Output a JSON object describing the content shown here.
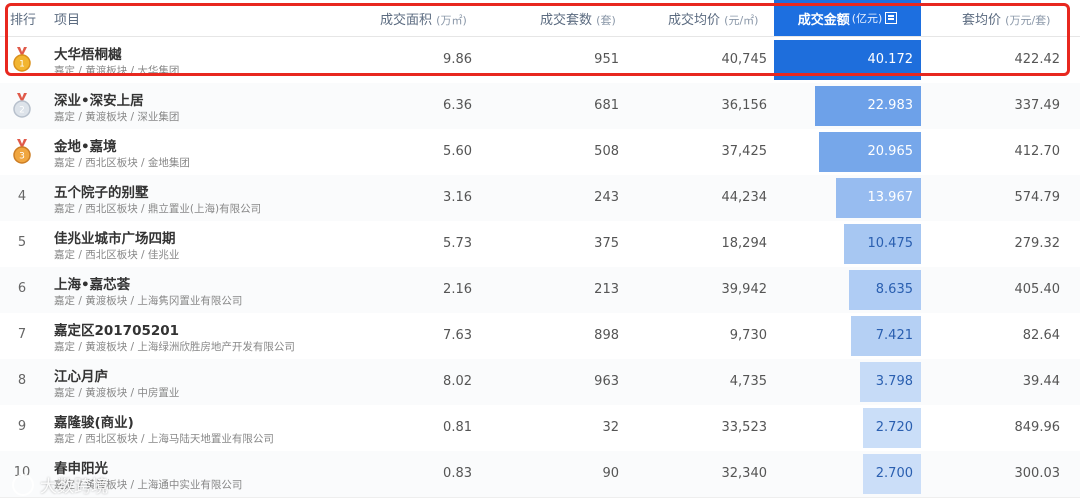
{
  "header": {
    "rank": "排行",
    "project": "项目",
    "area": "成交面积",
    "area_unit": "(万㎡)",
    "count": "成交套数",
    "count_unit": "(套)",
    "price": "成交均价",
    "price_unit": "(元/㎡)",
    "amount": "成交金额",
    "amount_unit": "(亿元)",
    "avg": "套均价",
    "avg_unit": "(万元/套)"
  },
  "rows": [
    {
      "rank": "1",
      "medal": "gold-medal-icon",
      "name": "大华梧桐樾",
      "sub": "嘉定 / 黄渡板块 / 大华集团",
      "area": "9.86",
      "count": "951",
      "price": "40,745",
      "amount": "40.172",
      "amount_value": 40.172,
      "avg": "422.42"
    },
    {
      "rank": "2",
      "medal": "silver-medal-icon",
      "name": "深业•深安上居",
      "sub": "嘉定 / 黄渡板块 / 深业集团",
      "area": "6.36",
      "count": "681",
      "price": "36,156",
      "amount": "22.983",
      "amount_value": 22.983,
      "avg": "337.49"
    },
    {
      "rank": "3",
      "medal": "bronze-medal-icon",
      "name": "金地•嘉境",
      "sub": "嘉定 / 西北区板块 / 金地集团",
      "area": "5.60",
      "count": "508",
      "price": "37,425",
      "amount": "20.965",
      "amount_value": 20.965,
      "avg": "412.70"
    },
    {
      "rank": "4",
      "name": "五个院子的别墅",
      "sub": "嘉定 / 西北区板块 / 鼎立置业(上海)有限公司",
      "area": "3.16",
      "count": "243",
      "price": "44,234",
      "amount": "13.967",
      "amount_value": 13.967,
      "avg": "574.79"
    },
    {
      "rank": "5",
      "name": "佳兆业城市广场四期",
      "sub": "嘉定 / 西北区板块 / 佳兆业",
      "area": "5.73",
      "count": "375",
      "price": "18,294",
      "amount": "10.475",
      "amount_value": 10.475,
      "avg": "279.32"
    },
    {
      "rank": "6",
      "name": "上海•嘉芯荟",
      "sub": "嘉定 / 黄渡板块 / 上海隽冈置业有限公司",
      "area": "2.16",
      "count": "213",
      "price": "39,942",
      "amount": "8.635",
      "amount_value": 8.635,
      "avg": "405.40"
    },
    {
      "rank": "7",
      "name": "嘉定区201705201",
      "sub": "嘉定 / 黄渡板块 / 上海绿洲欣胜房地产开发有限公司",
      "area": "7.63",
      "count": "898",
      "price": "9,730",
      "amount": "7.421",
      "amount_value": 7.421,
      "avg": "82.64"
    },
    {
      "rank": "8",
      "name": "江心月庐",
      "sub": "嘉定 / 黄渡板块 / 中房置业",
      "area": "8.02",
      "count": "963",
      "price": "4,735",
      "amount": "3.798",
      "amount_value": 3.798,
      "avg": "39.44"
    },
    {
      "rank": "9",
      "name": "嘉隆骏(商业)",
      "sub": "嘉定 / 西北区板块 / 上海马陆天地置业有限公司",
      "area": "0.81",
      "count": "32",
      "price": "33,523",
      "amount": "2.720",
      "amount_value": 2.72,
      "avg": "849.96"
    },
    {
      "rank": "10",
      "name": "春申阳光",
      "sub": "嘉定 / 黄渡板块 / 上海通中实业有限公司",
      "area": "0.83",
      "count": "90",
      "price": "32,340",
      "amount": "2.700",
      "amount_value": 2.7,
      "avg": "300.03"
    }
  ],
  "watermark": "大数跨境",
  "colors": {
    "accent": "#1d6fe0",
    "highlight_border": "#e8281f"
  }
}
